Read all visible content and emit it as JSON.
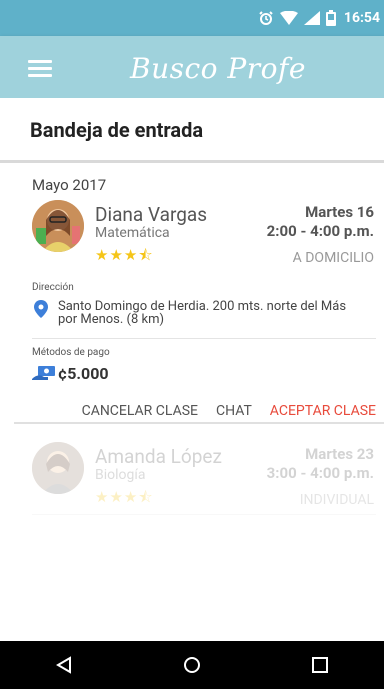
{
  "statusbar": {
    "time": "16:54"
  },
  "appbar": {
    "brand": "Busco Profe"
  },
  "inbox": {
    "title": "Bandeja de entrada"
  },
  "month": "Mayo 2017",
  "class1": {
    "teacher": "Diana Vargas",
    "subject": "Matemática",
    "rating": "★★★⯪",
    "date": "Martes 16",
    "time": "2:00 - 4:00 p.m.",
    "mode": "A DOMICILIO",
    "address_label": "Dirección",
    "address": "Santo Domingo de Herdia. 200 mts. norte del Más por Menos. (8 km)",
    "payment_label": "Métodos de pago",
    "payment_amount": "¢5.000",
    "actions": {
      "cancel": "CANCELAR CLASE",
      "chat": "CHAT",
      "accept": "ACEPTAR CLASE"
    }
  },
  "class2": {
    "teacher": "Amanda López",
    "subject": "Biología",
    "rating": "★★★⯪",
    "date": "Martes 23",
    "time": "3:00 - 4:00 p.m.",
    "mode": "INDIVIDUAL"
  },
  "colors": {
    "statusbar": "#5fb1c9",
    "appbar": "#9fd2dc",
    "accent": "#e84b3c",
    "star": "#f5c518"
  }
}
